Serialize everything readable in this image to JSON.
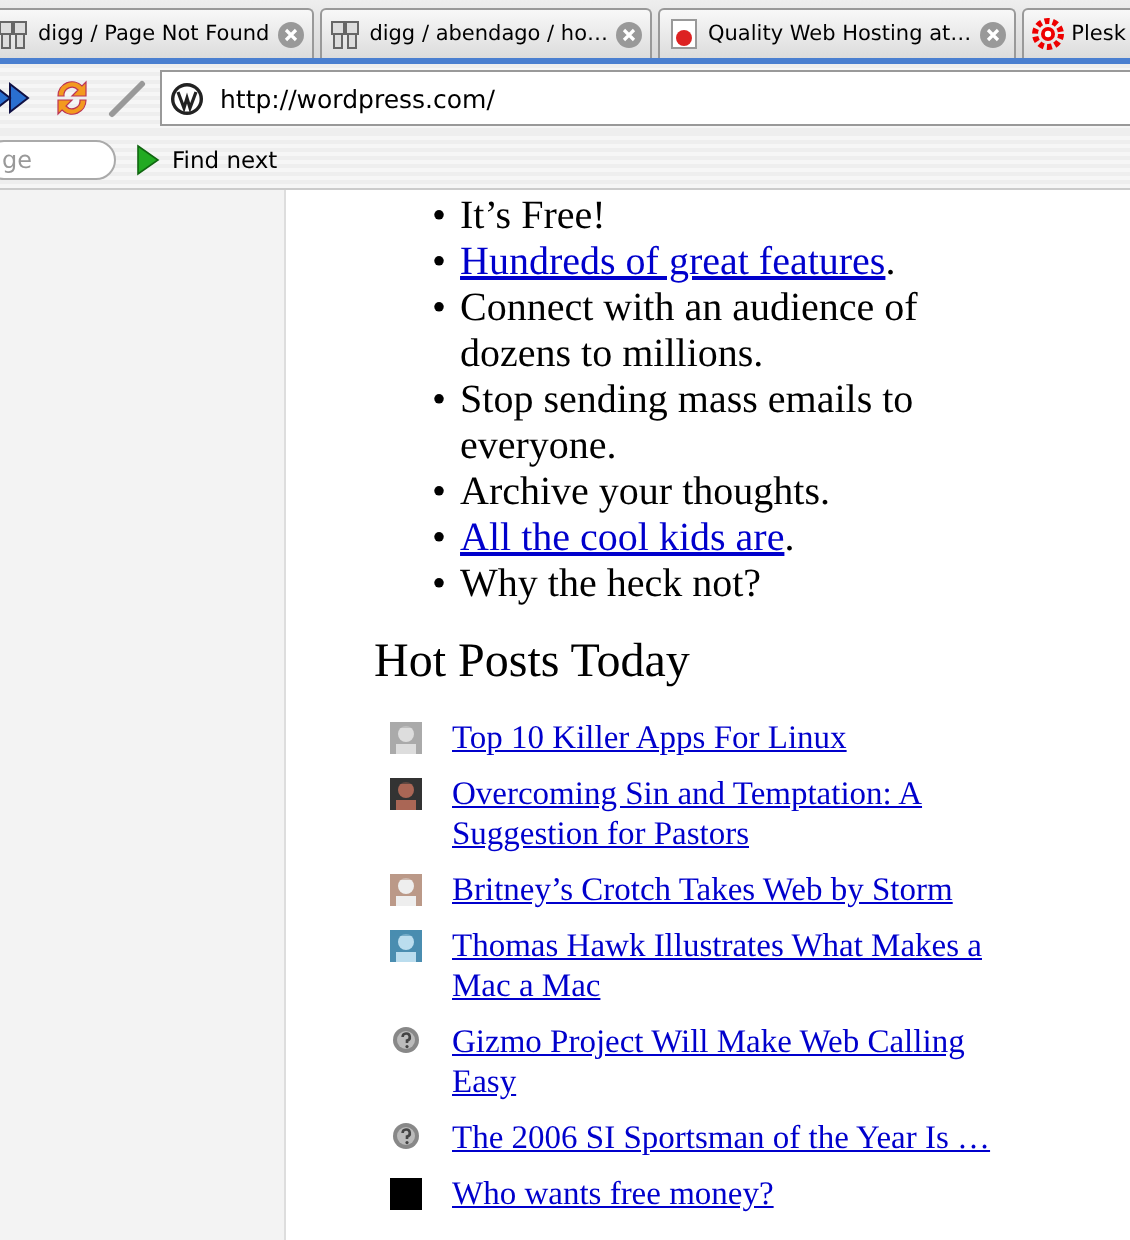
{
  "tabs": [
    {
      "title": "digg / Page Not Found"
    },
    {
      "title": "digg / abendago / ho…"
    },
    {
      "title": "Quality Web Hosting at…"
    },
    {
      "title": "Plesk"
    }
  ],
  "address": {
    "url": "http://wordpress.com/"
  },
  "find_bar": {
    "placeholder": "ge",
    "button": "Find next"
  },
  "features": [
    {
      "bullet": "•",
      "text": "It’s Free!",
      "link": false
    },
    {
      "bullet": "•",
      "text": "Hundreds of great features",
      "link": true,
      "after": "."
    },
    {
      "bullet": "•",
      "text": "Connect with an audience of dozens to millions.",
      "link": false
    },
    {
      "bullet": "•",
      "text": "Stop sending mass emails to everyone.",
      "link": false
    },
    {
      "bullet": "•",
      "text": "Archive your thoughts.",
      "link": false
    },
    {
      "bullet": "•",
      "text": "All the cool kids are",
      "link": true,
      "after": "."
    },
    {
      "bullet": "•",
      "text": "Why the heck not?",
      "link": false
    }
  ],
  "hot_posts": {
    "heading": "Hot Posts Today",
    "posts": [
      {
        "title": "Top 10 Killer Apps For Linux",
        "kind": "picture"
      },
      {
        "title": "Overcoming Sin and Temptation: A Suggestion for Pastors",
        "kind": "picture"
      },
      {
        "title": "Britney’s Crotch Takes Web by Storm",
        "kind": "picture"
      },
      {
        "title": "Thomas Hawk Illustrates What Makes a Mac a Mac",
        "kind": "picture"
      },
      {
        "title": "Gizmo Project Will Make Web Calling Easy",
        "kind": "unknown"
      },
      {
        "title": "The 2006 SI Sportsman of the Year Is …",
        "kind": "unknown"
      },
      {
        "title": "Who wants free money?",
        "kind": "blank"
      }
    ]
  }
}
